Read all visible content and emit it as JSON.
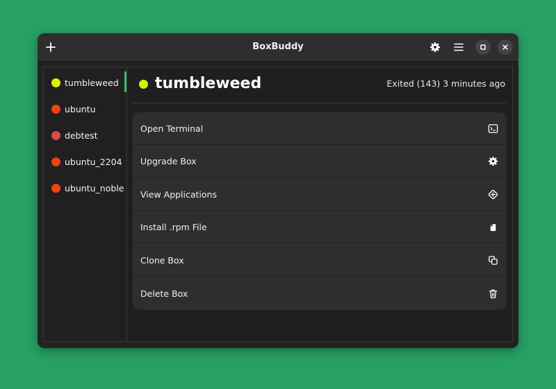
{
  "window": {
    "title": "BoxBuddy"
  },
  "headerbar": {
    "add_icon": "plus-icon",
    "settings_icon": "gear-icon",
    "menu_icon": "hamburger-menu-icon",
    "maximize_icon": "maximize-icon",
    "close_icon": "close-icon"
  },
  "sidebar": {
    "items": [
      {
        "label": "tumbleweed",
        "status_color": "#d8f000"
      },
      {
        "label": "ubuntu",
        "status_color": "#f0420e"
      },
      {
        "label": "debtest",
        "status_color": "#d94b4b"
      },
      {
        "label": "ubuntu_2204",
        "status_color": "#f0420e"
      },
      {
        "label": "ubuntu_noble",
        "status_color": "#f0420e"
      }
    ],
    "active_index": 0
  },
  "main": {
    "title": "tumbleweed",
    "status_color": "#d8f000",
    "status_text": "Exited (143) 3 minutes ago",
    "actions": [
      {
        "label": "Open Terminal",
        "icon": "terminal-icon"
      },
      {
        "label": "Upgrade Box",
        "icon": "gear-icon"
      },
      {
        "label": "View Applications",
        "icon": "apps-icon"
      },
      {
        "label": "Install .rpm File",
        "icon": "package-icon"
      },
      {
        "label": "Clone Box",
        "icon": "copy-icon"
      },
      {
        "label": "Delete Box",
        "icon": "trash-icon"
      }
    ]
  },
  "colors": {
    "background": "#27a064",
    "accent": "#3db86b",
    "window": "#222222",
    "headerbar": "#2e2e2e",
    "card": "#2e2e2e"
  }
}
